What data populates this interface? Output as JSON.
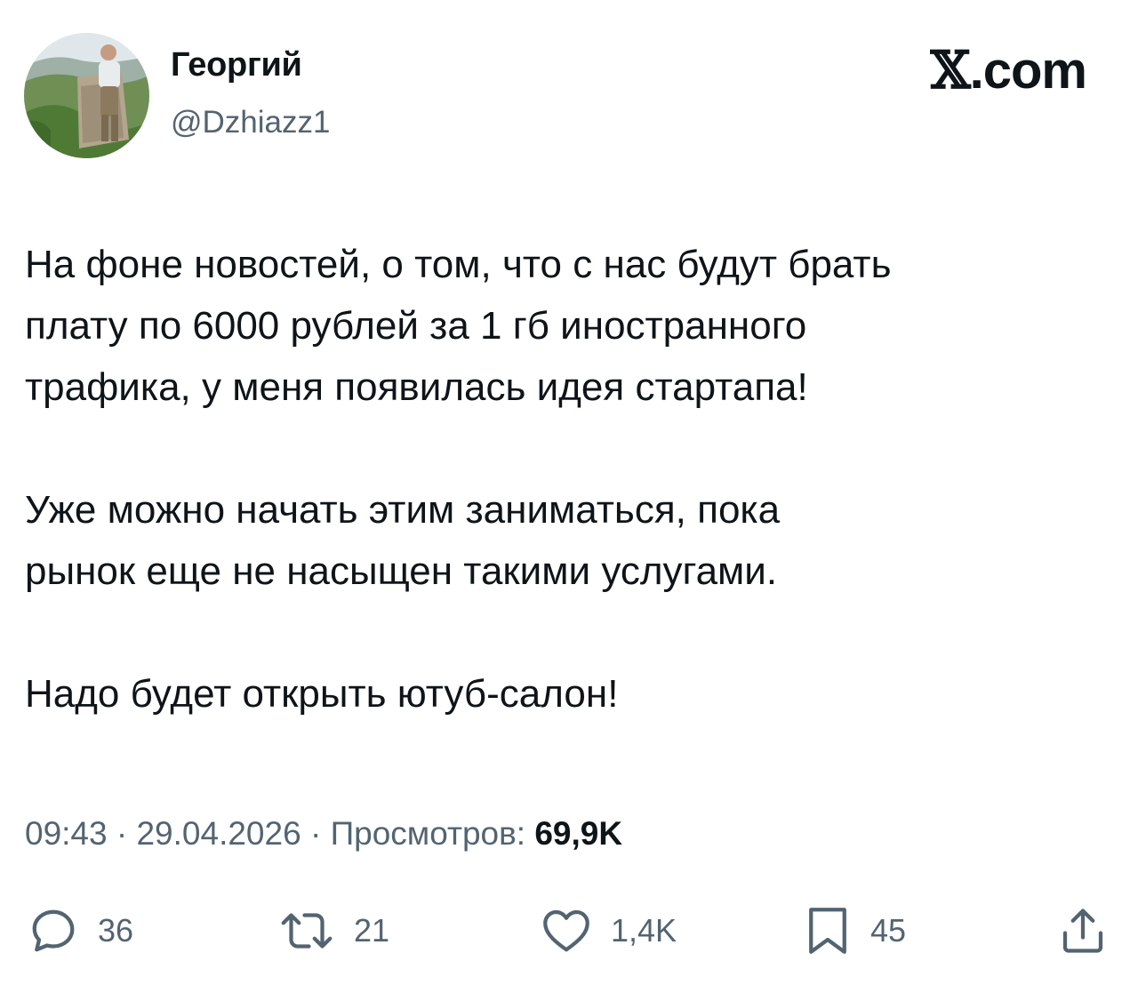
{
  "author": {
    "display_name": "Георгий",
    "handle": "@Dzhiazz1",
    "avatar_icon": "profile-photo"
  },
  "brand": {
    "x": "𝕏",
    "domain": ".com"
  },
  "tweet": {
    "paragraphs": [
      "На фоне новостей, о том, что с нас будут брать\nплату по 6000 рублей за 1 гб иностранного\nтрафика, у меня появилась идея стартапа!",
      "Уже можно начать этим заниматься, пока\nрынок еще не насыщен такими услугами.",
      "Надо будет открыть ютуб-салон!"
    ]
  },
  "meta": {
    "time": "09:43",
    "separator": " · ",
    "date": "29.04.2026",
    "views_label": "Просмотров:",
    "views_value": "69,9K"
  },
  "actions": {
    "reply_count": "36",
    "retweet_count": "21",
    "like_count": "1,4K",
    "bookmark_count": "45"
  },
  "colors": {
    "text": "#0f1419",
    "secondary": "#536471",
    "background": "#ffffff"
  }
}
